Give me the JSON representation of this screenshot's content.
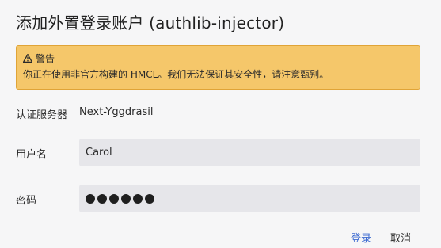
{
  "dialog": {
    "title": "添加外置登录账户 (authlib-injector)"
  },
  "warning": {
    "icon": "warning-triangle-icon",
    "title": "警告",
    "message": "你正在使用非官方构建的 HMCL。我们无法保证其安全性，请注意甄别。"
  },
  "form": {
    "server_label": "认证服务器",
    "server_value": "Next-Yggdrasil",
    "username_label": "用户名",
    "username_value": "Carol",
    "password_label": "密码",
    "password_mask_count": 6
  },
  "actions": {
    "login_label": "登录",
    "cancel_label": "取消"
  },
  "colors": {
    "warning_bg": "#f5c76a",
    "warning_border": "#e0a437",
    "input_bg": "#e6e6ea",
    "accent": "#3d6bd1"
  }
}
